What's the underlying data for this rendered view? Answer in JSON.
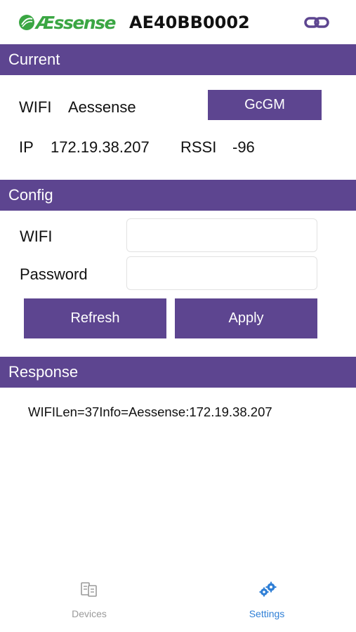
{
  "header": {
    "logo_text": "Æssense",
    "device_id": "AE40BB0002",
    "link_icon": "link-icon"
  },
  "current": {
    "title": "Current",
    "wifi_label": "WIFI",
    "wifi_value": "Aessense",
    "ssid_button": "GcGM",
    "ip_label": "IP",
    "ip_value": "172.19.38.207",
    "rssi_label": "RSSI",
    "rssi_value": "-96"
  },
  "config": {
    "title": "Config",
    "wifi_label": "WIFI",
    "wifi_value": "",
    "password_label": "Password",
    "password_value": "",
    "refresh_label": "Refresh",
    "apply_label": "Apply"
  },
  "response": {
    "title": "Response",
    "text": "WIFILen=37Info=Aessense:172.19.38.207"
  },
  "tabs": [
    {
      "label": "Devices",
      "icon": "devices-icon",
      "active": false
    },
    {
      "label": "Settings",
      "icon": "gears-icon",
      "active": true
    }
  ],
  "colors": {
    "accent": "#5d4590",
    "brand_green": "#3aa643",
    "tab_active": "#2f7fd6",
    "tab_inactive": "#9a9a9a"
  }
}
